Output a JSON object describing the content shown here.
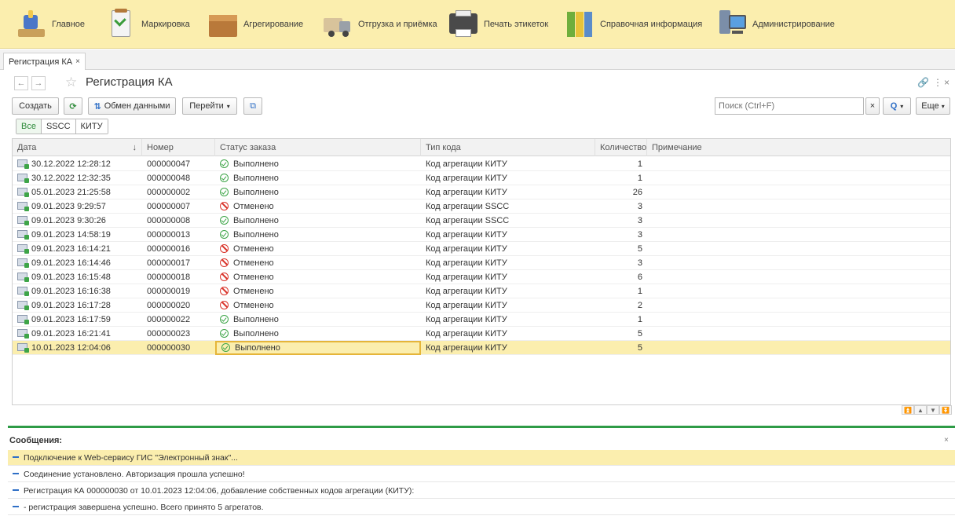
{
  "sections": [
    {
      "label": "Главное",
      "icon": "home-icon"
    },
    {
      "label": "Маркировка",
      "icon": "marking-icon"
    },
    {
      "label": "Агрегирование",
      "icon": "box-icon"
    },
    {
      "label": "Отгрузка и приёмка",
      "icon": "truck-icon"
    },
    {
      "label": "Печать этикеток",
      "icon": "printer-icon"
    },
    {
      "label": "Справочная информация",
      "icon": "books-icon"
    },
    {
      "label": "Администрирование",
      "icon": "admin-icon"
    }
  ],
  "tab": {
    "label": "Регистрация КА",
    "close": "×"
  },
  "form": {
    "title": "Регистрация КА",
    "back": "←",
    "forward": "→",
    "star": "☆",
    "link": "🔗",
    "more": "⋮",
    "close": "×"
  },
  "toolbar": {
    "create": "Создать",
    "exchange": "Обмен данными",
    "goto": "Перейти",
    "search_placeholder": "Поиск (Ctrl+F)",
    "search_clear": "×",
    "search_btn": "🔍",
    "more": "Еще"
  },
  "filters": [
    "Все",
    "SSCC",
    "КИТУ"
  ],
  "table": {
    "headers": [
      "Дата",
      "Номер",
      "Статус заказа",
      "Тип кода",
      "Количество",
      "Примечание"
    ],
    "sort_arrow": "↓",
    "rows": [
      {
        "date": "30.12.2022 12:28:12",
        "number": "000000047",
        "status": "Выполнено",
        "ok": true,
        "type": "Код агрегации КИТУ",
        "qty": "1"
      },
      {
        "date": "30.12.2022 12:32:35",
        "number": "000000048",
        "status": "Выполнено",
        "ok": true,
        "type": "Код агрегации КИТУ",
        "qty": "1"
      },
      {
        "date": "05.01.2023 21:25:58",
        "number": "000000002",
        "status": "Выполнено",
        "ok": true,
        "type": "Код агрегации КИТУ",
        "qty": "26"
      },
      {
        "date": "09.01.2023 9:29:57",
        "number": "000000007",
        "status": "Отменено",
        "ok": false,
        "type": "Код агрегации SSCC",
        "qty": "3"
      },
      {
        "date": "09.01.2023 9:30:26",
        "number": "000000008",
        "status": "Выполнено",
        "ok": true,
        "type": "Код агрегации SSCC",
        "qty": "3"
      },
      {
        "date": "09.01.2023 14:58:19",
        "number": "000000013",
        "status": "Выполнено",
        "ok": true,
        "type": "Код агрегации КИТУ",
        "qty": "3"
      },
      {
        "date": "09.01.2023 16:14:21",
        "number": "000000016",
        "status": "Отменено",
        "ok": false,
        "type": "Код агрегации КИТУ",
        "qty": "5"
      },
      {
        "date": "09.01.2023 16:14:46",
        "number": "000000017",
        "status": "Отменено",
        "ok": false,
        "type": "Код агрегации КИТУ",
        "qty": "3"
      },
      {
        "date": "09.01.2023 16:15:48",
        "number": "000000018",
        "status": "Отменено",
        "ok": false,
        "type": "Код агрегации КИТУ",
        "qty": "6"
      },
      {
        "date": "09.01.2023 16:16:38",
        "number": "000000019",
        "status": "Отменено",
        "ok": false,
        "type": "Код агрегации КИТУ",
        "qty": "1"
      },
      {
        "date": "09.01.2023 16:17:28",
        "number": "000000020",
        "status": "Отменено",
        "ok": false,
        "type": "Код агрегации КИТУ",
        "qty": "2"
      },
      {
        "date": "09.01.2023 16:17:59",
        "number": "000000022",
        "status": "Выполнено",
        "ok": true,
        "type": "Код агрегации КИТУ",
        "qty": "1"
      },
      {
        "date": "09.01.2023 16:21:41",
        "number": "000000023",
        "status": "Выполнено",
        "ok": true,
        "type": "Код агрегации КИТУ",
        "qty": "5"
      },
      {
        "date": "10.01.2023 12:04:06",
        "number": "000000030",
        "status": "Выполнено",
        "ok": true,
        "type": "Код агрегации КИТУ",
        "qty": "5",
        "selected": true
      }
    ]
  },
  "messages": {
    "title": "Сообщения:",
    "close": "×",
    "items": [
      "Подключение к Web-сервису ГИС \"Электронный знак\"...",
      "Соединение установлено. Авторизация прошла успешно!",
      "Регистрация КА 000000030 от 10.01.2023 12:04:06, добавление собственных кодов агрегации (КИТУ):",
      "- регистрация завершена успешно. Всего принято 5 агрегатов."
    ]
  },
  "colors": {
    "section_bar": "#fbeeae",
    "accent_green": "#2e9b46",
    "selected_row": "#fbeeae"
  }
}
